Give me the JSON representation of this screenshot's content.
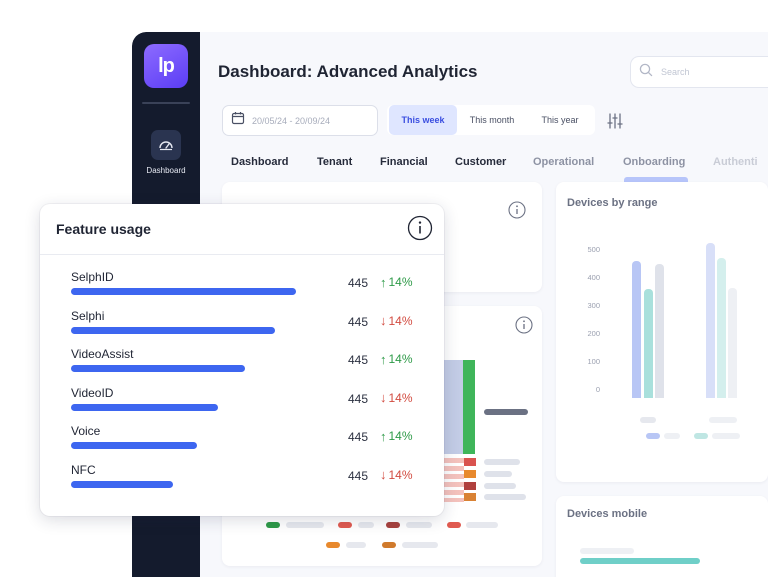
{
  "app": {
    "logo_text": "lp",
    "title": "Dashboard: Advanced Analytics",
    "search_placeholder": "Search",
    "sidebar": {
      "items": [
        {
          "label": "Dashboard",
          "icon": "gauge-icon"
        }
      ]
    }
  },
  "filters": {
    "date_range": "20/05/24 - 20/09/24",
    "periods": [
      "This week",
      "This month",
      "This year"
    ],
    "active_period": "This week"
  },
  "tabs": [
    "Dashboard",
    "Tenant",
    "Financial",
    "Customer",
    "Operational",
    "Onboarding",
    "Authenti"
  ],
  "active_tab": "Onboarding",
  "devices_by_range": {
    "title": "Devices by range",
    "y_ticks": [
      "500",
      "400",
      "300",
      "200",
      "100",
      "0"
    ]
  },
  "devices_mobile": {
    "title": "Devices mobile"
  },
  "feature_usage": {
    "title": "Feature usage",
    "rows": [
      {
        "name": "SelphID",
        "value": "445",
        "change": "14%",
        "direction": "up",
        "fill": 0.75
      },
      {
        "name": "Selphi",
        "value": "445",
        "change": "14%",
        "direction": "down",
        "fill": 0.68
      },
      {
        "name": "VideoAssist",
        "value": "445",
        "change": "14%",
        "direction": "up",
        "fill": 0.58
      },
      {
        "name": "VideoID",
        "value": "445",
        "change": "14%",
        "direction": "down",
        "fill": 0.49
      },
      {
        "name": "Voice",
        "value": "445",
        "change": "14%",
        "direction": "up",
        "fill": 0.42
      },
      {
        "name": "NFC",
        "value": "445",
        "change": "14%",
        "direction": "down",
        "fill": 0.34
      }
    ],
    "colors": {
      "bar": "#3d66f0",
      "up": "#2e9a48",
      "down": "#d24b40"
    }
  }
}
